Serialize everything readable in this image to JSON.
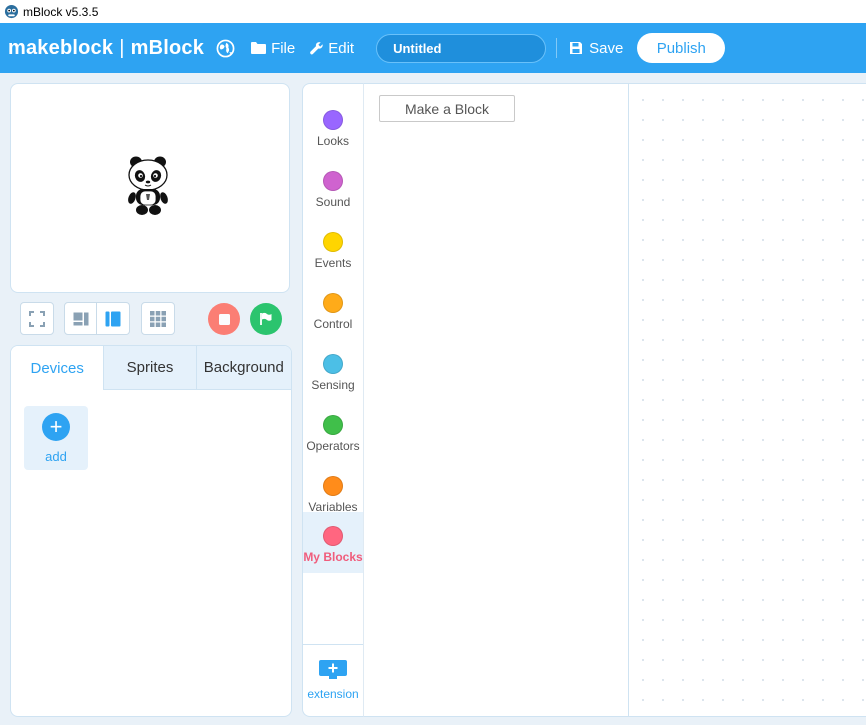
{
  "window": {
    "title": "mBlock v5.3.5"
  },
  "menubar": {
    "brand_left": "makeblock",
    "brand_sep": "|",
    "brand_right": "mBlock",
    "file_label": "File",
    "edit_label": "Edit",
    "project_name": "Untitled",
    "save_label": "Save",
    "publish_label": "Publish"
  },
  "device_panel": {
    "tabs": [
      {
        "label": "Devices"
      },
      {
        "label": "Sprites"
      },
      {
        "label": "Background"
      }
    ],
    "add_label": "add"
  },
  "categories": [
    {
      "label": "Looks",
      "color": "#9966ff"
    },
    {
      "label": "Sound",
      "color": "#cf63cf"
    },
    {
      "label": "Events",
      "color": "#ffd500"
    },
    {
      "label": "Control",
      "color": "#ffab19"
    },
    {
      "label": "Sensing",
      "color": "#4cbfe6"
    },
    {
      "label": "Operators",
      "color": "#40bf4a"
    },
    {
      "label": "Variables",
      "color": "#ff8c1a"
    },
    {
      "label": "My Blocks",
      "color": "#ff6680"
    }
  ],
  "extension_label": "extension",
  "palette": {
    "make_block_label": "Make a Block"
  },
  "colors": {
    "accent": "#2ea3f2",
    "stop": "#ff6b5e",
    "go": "#2bc46e",
    "active_category": "#f05d7c"
  }
}
